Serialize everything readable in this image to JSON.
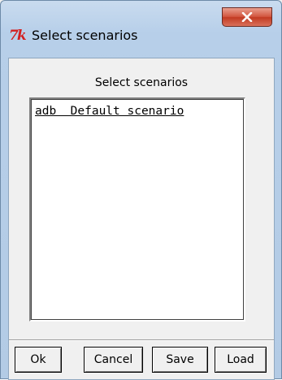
{
  "window": {
    "title": "Select scenarios",
    "app_icon_glyph": "7k",
    "app_icon_name": "tk-feather-icon",
    "close_icon_name": "close-icon"
  },
  "dialog": {
    "heading": "Select scenarios",
    "scenarios": [
      {
        "text": "adb  Default scenario"
      }
    ]
  },
  "buttons": {
    "ok": "Ok",
    "cancel": "Cancel",
    "save": "Save",
    "load": "Load"
  },
  "colors": {
    "frame": "#b7cfe9",
    "close_button": "#c23a22",
    "client_background": "#f0f0f0",
    "list_background": "#ffffff"
  }
}
